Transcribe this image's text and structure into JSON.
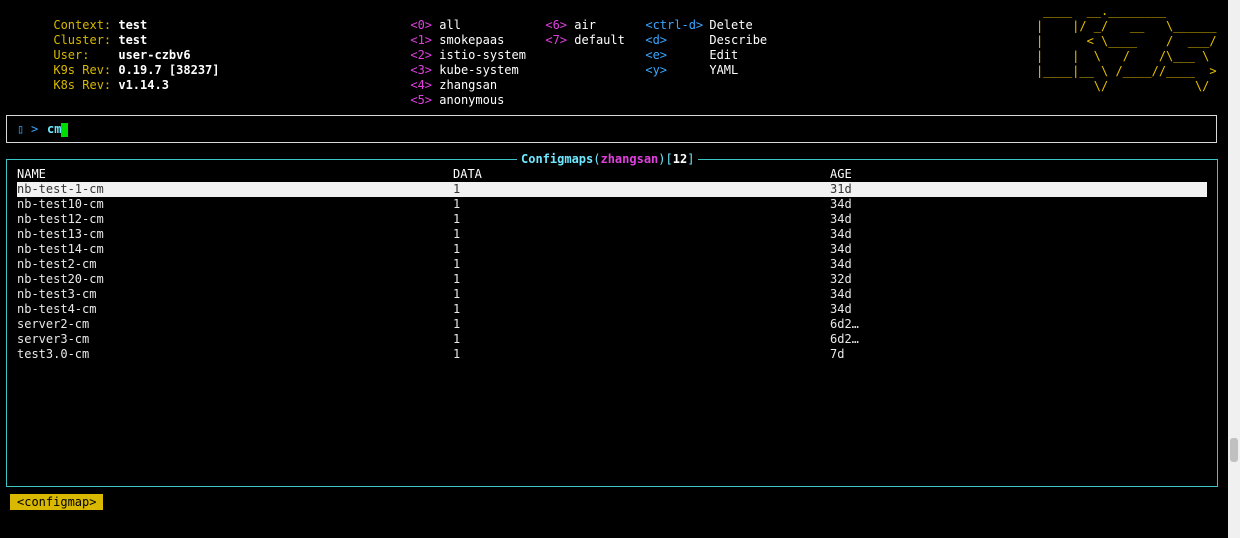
{
  "info": [
    {
      "label": "Context:",
      "value": "test"
    },
    {
      "label": "Cluster:",
      "value": "test"
    },
    {
      "label": "User:",
      "value": "user-czbv6"
    },
    {
      "label": "K9s Rev:",
      "value": "0.19.7 [38237]"
    },
    {
      "label": "K8s Rev:",
      "value": "v1.14.3"
    }
  ],
  "namespaces_col1": [
    {
      "key": "<0>",
      "name": "all"
    },
    {
      "key": "<1>",
      "name": "smokepaas"
    },
    {
      "key": "<2>",
      "name": "istio-system"
    },
    {
      "key": "<3>",
      "name": "kube-system"
    },
    {
      "key": "<4>",
      "name": "zhangsan"
    },
    {
      "key": "<5>",
      "name": "anonymous"
    }
  ],
  "namespaces_col2": [
    {
      "key": "<6>",
      "name": "air"
    },
    {
      "key": "<7>",
      "name": "default"
    }
  ],
  "actions": [
    {
      "key": "<ctrl-d>",
      "name": "Delete"
    },
    {
      "key": "<d>",
      "name": "Describe"
    },
    {
      "key": "<e>",
      "name": "Edit"
    },
    {
      "key": "<y>",
      "name": "YAML"
    }
  ],
  "logo_icon": "k9s-ascii-logo",
  "prompt": {
    "icon": "dog-icon",
    "caret": ">",
    "text": "cm"
  },
  "table": {
    "title": "Configmaps",
    "namespace": "zhangsan",
    "count": "12",
    "columns": [
      "NAME",
      "DATA",
      "AGE"
    ],
    "rows": [
      {
        "name": "nb-test-1-cm",
        "data": "1",
        "age": "31d"
      },
      {
        "name": "nb-test10-cm",
        "data": "1",
        "age": "34d"
      },
      {
        "name": "nb-test12-cm",
        "data": "1",
        "age": "34d"
      },
      {
        "name": "nb-test13-cm",
        "data": "1",
        "age": "34d"
      },
      {
        "name": "nb-test14-cm",
        "data": "1",
        "age": "34d"
      },
      {
        "name": "nb-test2-cm",
        "data": "1",
        "age": "34d"
      },
      {
        "name": "nb-test20-cm",
        "data": "1",
        "age": "32d"
      },
      {
        "name": "nb-test3-cm",
        "data": "1",
        "age": "34d"
      },
      {
        "name": "nb-test4-cm",
        "data": "1",
        "age": "34d"
      },
      {
        "name": "server2-cm",
        "data": "1",
        "age": "6d2…"
      },
      {
        "name": "server3-cm",
        "data": "1",
        "age": "6d2…"
      },
      {
        "name": "test3.0-cm",
        "data": "1",
        "age": "7d"
      }
    ],
    "selected_index": 0
  },
  "crumb": "<configmap>",
  "colors": {
    "label_yellow": "#d8b800",
    "key_magenta": "#e040e0",
    "key_blue": "#3aa6ff",
    "frame_cyan": "#3cc3c3"
  }
}
